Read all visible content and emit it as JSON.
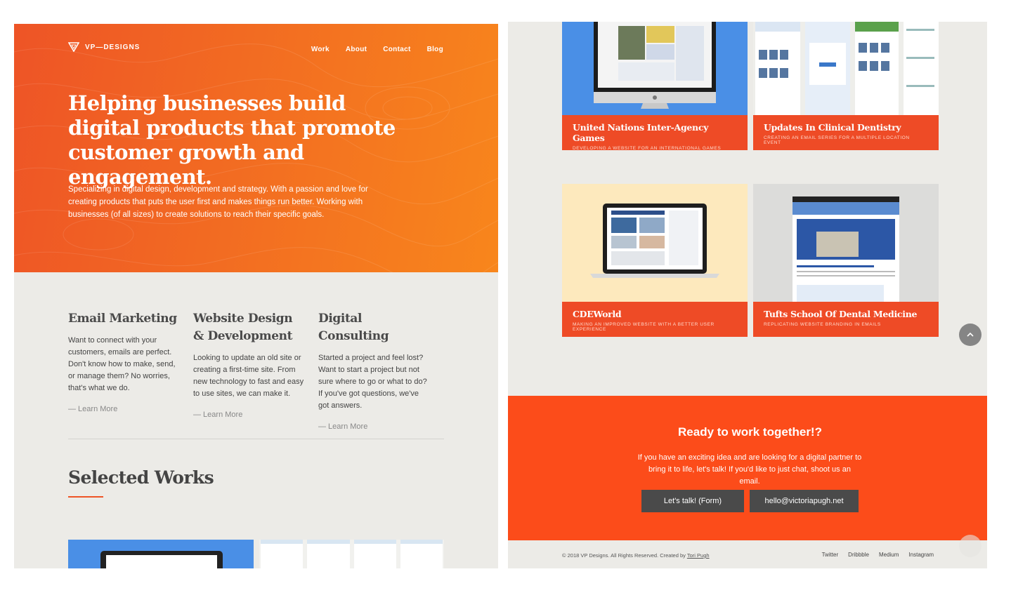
{
  "brand": {
    "logo_text": "VP—DESIGNS",
    "accent": "#ee5426",
    "cta_bg": "#fc4c1a",
    "dark_button": "#4a4a4a"
  },
  "nav": {
    "items": [
      {
        "label": "Work"
      },
      {
        "label": "About"
      },
      {
        "label": "Contact"
      },
      {
        "label": "Blog"
      }
    ]
  },
  "hero": {
    "title": "Helping businesses build digital products that promote customer growth and engagement.",
    "text": "Specializing in digital design, development and strategy. With a passion and love for creating products that puts the user first and makes things run better. Working with businesses (of all sizes) to create solutions to reach their specific goals."
  },
  "services": [
    {
      "title": "Email Marketing",
      "text": "Want to connect with your customers, emails are perfect. Don't know how to make, send, or manage them? No worries, that's what we do.",
      "link": "— Learn More"
    },
    {
      "title": "Website Design & Development",
      "text": "Looking to update an old site or creating a first-time site. From new technology to fast and easy to use sites, we can make it.",
      "link": "— Learn More"
    },
    {
      "title": "Digital Consulting",
      "text": "Started a project and feel lost? Want to start a project but not sure where to go or what to do? If you've got questions, we've got answers.",
      "link": "— Learn More"
    }
  ],
  "works": {
    "title": "Selected Works",
    "items": [
      {
        "title": "United Nations Inter-Agency Games",
        "subtitle": "Developing a website for an international games"
      },
      {
        "title": "Updates In Clinical Dentistry",
        "subtitle": "Creating an email series for a multiple location event"
      },
      {
        "title": "CDEWorld",
        "subtitle": "Making an improved website with a better user experience"
      },
      {
        "title": "Tufts School Of Dental Medicine",
        "subtitle": "Replicating website branding in emails"
      }
    ]
  },
  "cta": {
    "title": "Ready to work together!?",
    "text": "If you have an exciting idea and are looking for a digital partner to bring it to life, let's talk! If you'd like to just chat, shoot us an email.",
    "form_button": "Let's talk! (Form)",
    "email_button": "hello@victoriapugh.net"
  },
  "footer": {
    "copyright": "© 2018 VP Designs. All Rights Reserved. Created by",
    "author": "Tori Pugh",
    "links": [
      "Twitter",
      "Dribbble",
      "Medium",
      "Instagram"
    ]
  },
  "icons": {
    "logo": "triangle-logo-icon",
    "scroll_top": "chevron-up-icon"
  }
}
